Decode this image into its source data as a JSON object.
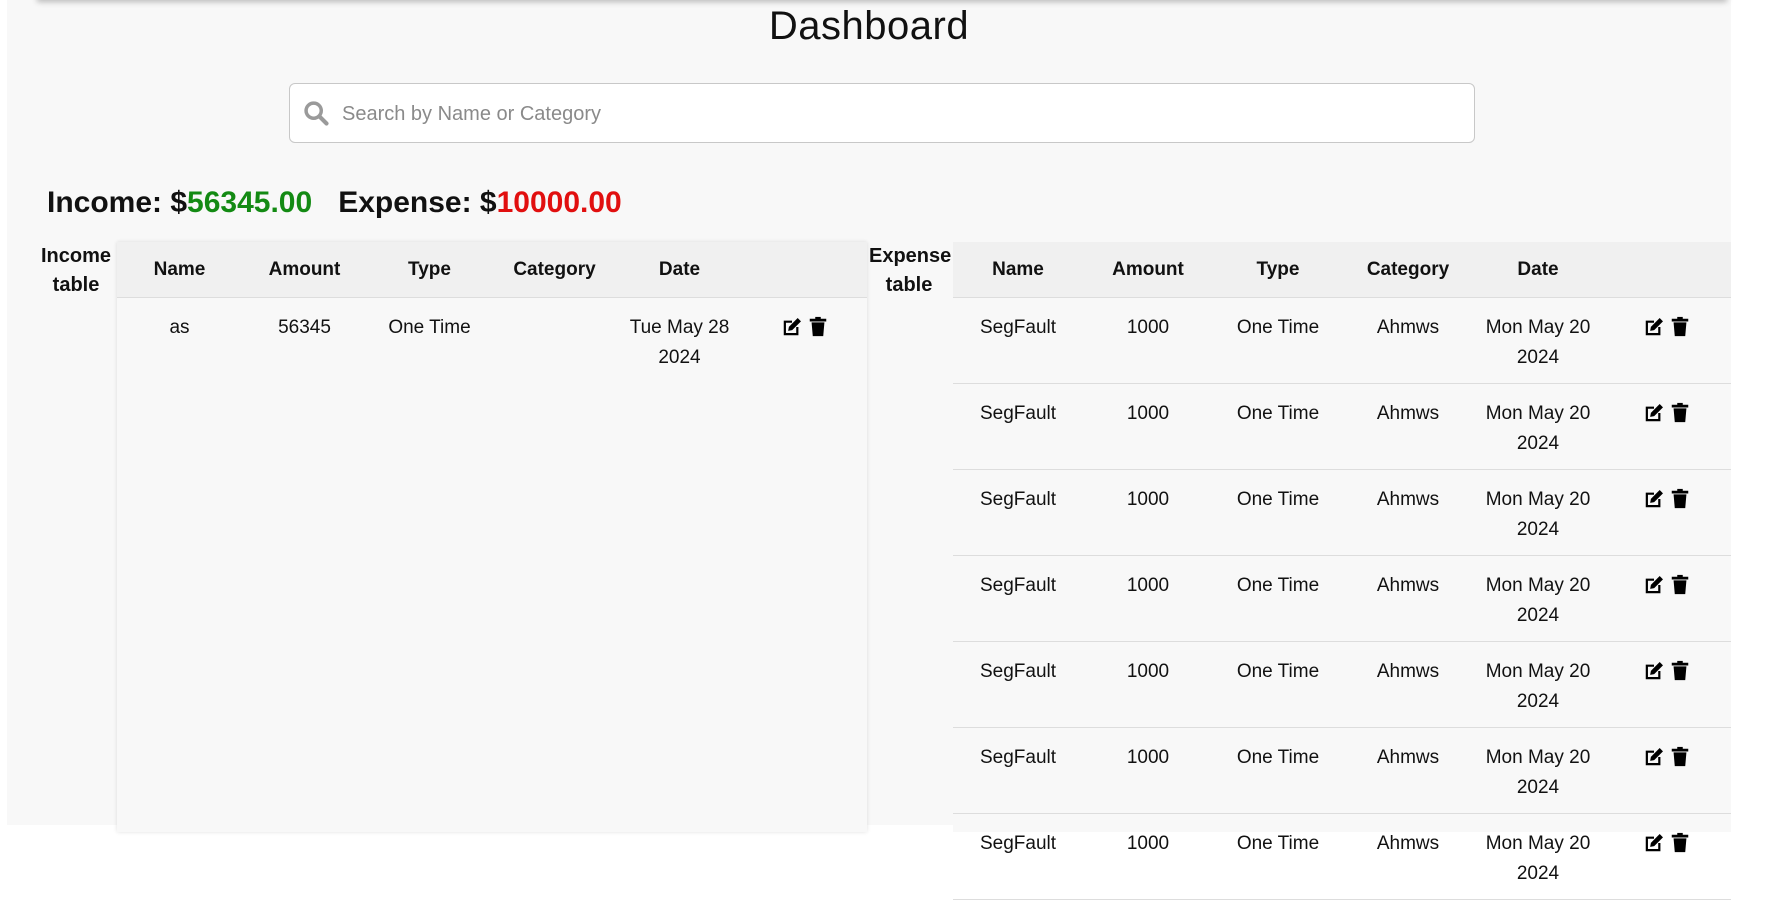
{
  "header": {
    "title": "Dashboard"
  },
  "search": {
    "placeholder": "Search by Name or Category",
    "value": ""
  },
  "totals": {
    "income_label": "Income: $",
    "income_value": "56345.00",
    "expense_label": "Expense: $",
    "expense_value": "10000.00",
    "income_color": "#138a13",
    "expense_color": "#e10f0f"
  },
  "income_table": {
    "caption": "Income table",
    "columns": [
      "Name",
      "Amount",
      "Type",
      "Category",
      "Date",
      ""
    ],
    "rows": [
      {
        "name": "as",
        "amount": "56345",
        "type": "One Time",
        "category": "",
        "date": "Tue May 28 2024"
      }
    ]
  },
  "expense_table": {
    "caption": "Expense table",
    "columns": [
      "Name",
      "Amount",
      "Type",
      "Category",
      "Date",
      ""
    ],
    "rows": [
      {
        "name": "SegFault",
        "amount": "1000",
        "type": "One Time",
        "category": "Ahmws",
        "date": "Mon May 20 2024"
      },
      {
        "name": "SegFault",
        "amount": "1000",
        "type": "One Time",
        "category": "Ahmws",
        "date": "Mon May 20 2024"
      },
      {
        "name": "SegFault",
        "amount": "1000",
        "type": "One Time",
        "category": "Ahmws",
        "date": "Mon May 20 2024"
      },
      {
        "name": "SegFault",
        "amount": "1000",
        "type": "One Time",
        "category": "Ahmws",
        "date": "Mon May 20 2024"
      },
      {
        "name": "SegFault",
        "amount": "1000",
        "type": "One Time",
        "category": "Ahmws",
        "date": "Mon May 20 2024"
      },
      {
        "name": "SegFault",
        "amount": "1000",
        "type": "One Time",
        "category": "Ahmws",
        "date": "Mon May 20 2024"
      },
      {
        "name": "SegFault",
        "amount": "1000",
        "type": "One Time",
        "category": "Ahmws",
        "date": "Mon May 20 2024"
      }
    ]
  },
  "icons": {
    "search": "search-icon",
    "edit": "edit-icon",
    "delete": "trash-icon"
  }
}
